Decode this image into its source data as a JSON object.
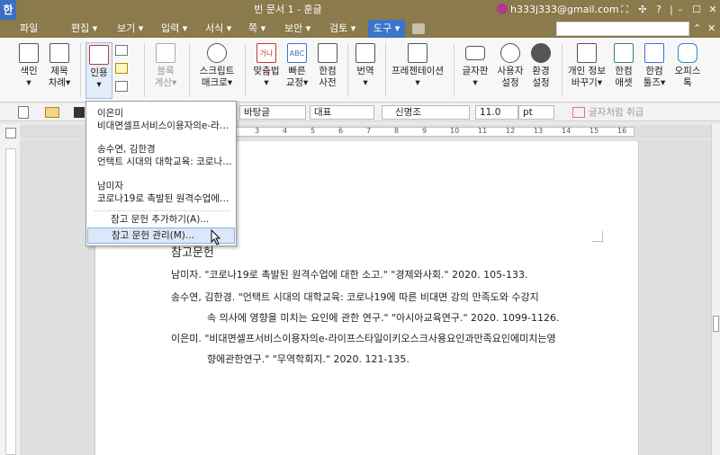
{
  "titlebar": {
    "app_letter": "한",
    "title": "빈 문서 1 - 훈글",
    "account": "h333j333@gmail.com",
    "controls": [
      "⛶",
      "✣",
      "?",
      "|",
      "–",
      "☐",
      "✕"
    ]
  },
  "menubar": {
    "items": [
      "파일",
      "편집 ▾",
      "보기 ▾",
      "입력 ▾",
      "서식 ▾",
      "쪽 ▾",
      "보안 ▾",
      "검토 ▾",
      "도구 ▾"
    ],
    "close": "✕",
    "up": "⌃"
  },
  "ribbon": {
    "buttons": [
      {
        "l1": "색인",
        "l2": "▾"
      },
      {
        "l1": "제목",
        "l2": "차례▾"
      },
      {
        "l1": "인용",
        "l2": "▾"
      },
      {
        "l1": "블록",
        "l2": "계산▾"
      },
      {
        "l1": "스크립트",
        "l2": "매크로▾"
      },
      {
        "l1": "맞춤법",
        "l2": "▾"
      },
      {
        "l1": "빠른",
        "l2": "교정▾"
      },
      {
        "l1": "한컴",
        "l2": "사전"
      },
      {
        "l1": "번역",
        "l2": "▾"
      },
      {
        "l1": "프레젠테이션",
        "l2": "▾"
      },
      {
        "l1": "글자판",
        "l2": "▾"
      },
      {
        "l1": "사용자",
        "l2": "설정"
      },
      {
        "l1": "환경",
        "l2": "설정"
      },
      {
        "l1": "개인 정보",
        "l2": "바꾸기▾"
      },
      {
        "l1": "한컴",
        "l2": "애셋"
      },
      {
        "l1": "한컴",
        "l2": "툴즈▾"
      },
      {
        "l1": "오피스",
        "l2": "톡"
      }
    ],
    "spell_caption": "가나다",
    "quick_caption": "ABC"
  },
  "toolbar": {
    "style": "바탕글",
    "lang": "대표",
    "font": "신명조",
    "size": "11.0",
    "unit": "pt",
    "format_label": "글자처럼 취급"
  },
  "document": {
    "heading": "참고문헌",
    "refs": [
      {
        "line1": "남미자. \"코로나19로 촉발된 원격수업에 대한 소고.\" \"경제와사회.\" 2020. 105-133.",
        "line2": ""
      },
      {
        "line1": "송수연, 김한경. \"언택트 시대의 대학교육: 코로나19에 따른 비대면 강의 만족도와 수강지",
        "line2": "속 의사에 영향을 미치는 요인에 관한 연구.\" \"아시아교육연구.\" 2020. 1099-1126."
      },
      {
        "line1": "이은미. \"비대면셀프서비스이용자의e-라이프스타일이키오스크사용요인과만족요인에미치는영",
        "line2": "향에관한연구.\" \"무역학회지.\" 2020. 121-135."
      }
    ]
  },
  "dropdown": {
    "citations": [
      {
        "author": "이은미",
        "title": "비대면셀프서비스이용자의e-라…"
      },
      {
        "author": "송수연, 김한경",
        "title": "언택트 시대의 대학교육: 코로나…"
      },
      {
        "author": "남미자",
        "title": "코로나19로 촉발된 원격수업에…"
      }
    ],
    "add": "참고 문헌 추가하기(A)...",
    "manage": "참고 문헌 관리(M)..."
  },
  "ruler": {
    "ticks": [
      "3",
      "4",
      "5",
      "6",
      "7",
      "8",
      "9",
      "10",
      "11",
      "12",
      "13",
      "14",
      "15",
      "16"
    ]
  },
  "colors": {
    "titlebar": "#8a7a4c",
    "active_menu": "#3a76c9",
    "highlight": "#dbe8fa"
  }
}
